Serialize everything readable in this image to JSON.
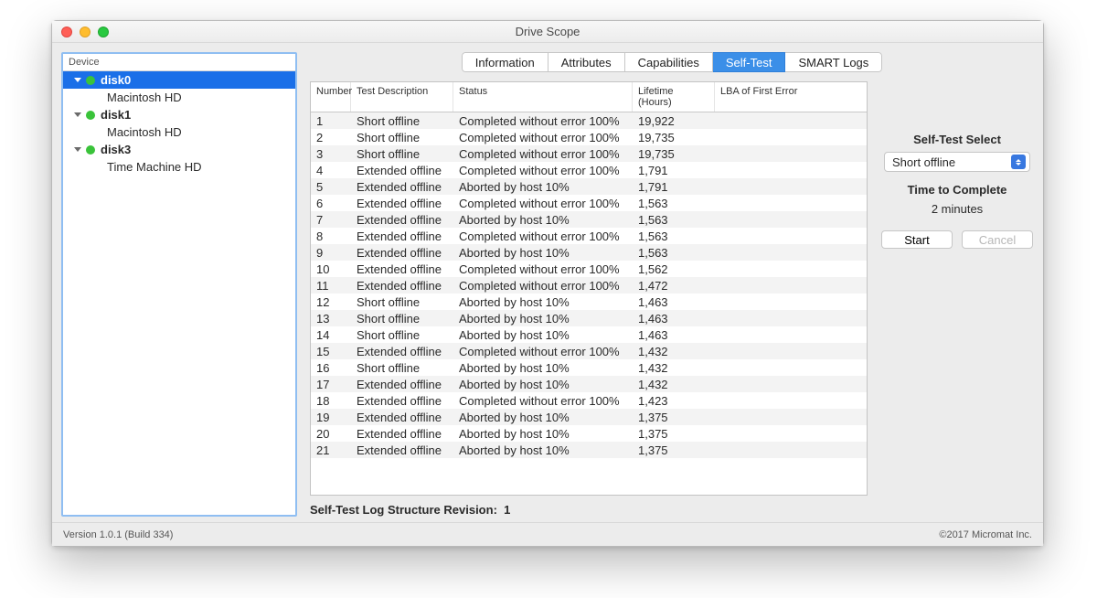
{
  "window": {
    "title": "Drive Scope"
  },
  "sidebar": {
    "header": "Device",
    "disks": [
      {
        "name": "disk0",
        "selected": true,
        "volumes": [
          "Macintosh HD"
        ]
      },
      {
        "name": "disk1",
        "selected": false,
        "volumes": [
          "Macintosh HD"
        ]
      },
      {
        "name": "disk3",
        "selected": false,
        "volumes": [
          "Time Machine HD"
        ]
      }
    ]
  },
  "tabs": {
    "items": [
      "Information",
      "Attributes",
      "Capabilities",
      "Self-Test",
      "SMART Logs"
    ],
    "active": "Self-Test"
  },
  "table": {
    "headers": {
      "num": "Number",
      "desc": "Test Description",
      "status": "Status",
      "life": "Lifetime (Hours)",
      "lba": "LBA of First Error"
    },
    "rows": [
      {
        "n": "1",
        "desc": "Short offline",
        "status": "Completed without error 100%",
        "life": "19,922",
        "lba": ""
      },
      {
        "n": "2",
        "desc": "Short offline",
        "status": "Completed without error 100%",
        "life": "19,735",
        "lba": ""
      },
      {
        "n": "3",
        "desc": "Short offline",
        "status": "Completed without error 100%",
        "life": "19,735",
        "lba": ""
      },
      {
        "n": "4",
        "desc": "Extended offline",
        "status": "Completed without error 100%",
        "life": "1,791",
        "lba": ""
      },
      {
        "n": "5",
        "desc": "Extended offline",
        "status": "Aborted by host 10%",
        "life": "1,791",
        "lba": ""
      },
      {
        "n": "6",
        "desc": "Extended offline",
        "status": "Completed without error 100%",
        "life": "1,563",
        "lba": ""
      },
      {
        "n": "7",
        "desc": "Extended offline",
        "status": "Aborted by host 10%",
        "life": "1,563",
        "lba": ""
      },
      {
        "n": "8",
        "desc": "Extended offline",
        "status": "Completed without error 100%",
        "life": "1,563",
        "lba": ""
      },
      {
        "n": "9",
        "desc": "Extended offline",
        "status": "Aborted by host 10%",
        "life": "1,563",
        "lba": ""
      },
      {
        "n": "10",
        "desc": "Extended offline",
        "status": "Completed without error 100%",
        "life": "1,562",
        "lba": ""
      },
      {
        "n": "11",
        "desc": "Extended offline",
        "status": "Completed without error 100%",
        "life": "1,472",
        "lba": ""
      },
      {
        "n": "12",
        "desc": "Short offline",
        "status": "Aborted by host 10%",
        "life": "1,463",
        "lba": ""
      },
      {
        "n": "13",
        "desc": "Short offline",
        "status": "Aborted by host 10%",
        "life": "1,463",
        "lba": ""
      },
      {
        "n": "14",
        "desc": "Short offline",
        "status": "Aborted by host 10%",
        "life": "1,463",
        "lba": ""
      },
      {
        "n": "15",
        "desc": "Extended offline",
        "status": "Completed without error 100%",
        "life": "1,432",
        "lba": ""
      },
      {
        "n": "16",
        "desc": "Short offline",
        "status": "Aborted by host 10%",
        "life": "1,432",
        "lba": ""
      },
      {
        "n": "17",
        "desc": "Extended offline",
        "status": "Aborted by host 10%",
        "life": "1,432",
        "lba": ""
      },
      {
        "n": "18",
        "desc": "Extended offline",
        "status": "Completed without error 100%",
        "life": "1,423",
        "lba": ""
      },
      {
        "n": "19",
        "desc": "Extended offline",
        "status": "Aborted by host 10%",
        "life": "1,375",
        "lba": ""
      },
      {
        "n": "20",
        "desc": "Extended offline",
        "status": "Aborted by host 10%",
        "life": "1,375",
        "lba": ""
      },
      {
        "n": "21",
        "desc": "Extended offline",
        "status": "Aborted by host 10%",
        "life": "1,375",
        "lba": ""
      }
    ]
  },
  "revision": {
    "label": "Self-Test Log Structure Revision:",
    "value": "1"
  },
  "side": {
    "select_label": "Self-Test Select",
    "select_value": "Short offline",
    "time_label": "Time to Complete",
    "time_value": "2 minutes",
    "start": "Start",
    "cancel": "Cancel"
  },
  "footer": {
    "version": "Version 1.0.1 (Build 334)",
    "copyright": "©2017 Micromat Inc."
  }
}
